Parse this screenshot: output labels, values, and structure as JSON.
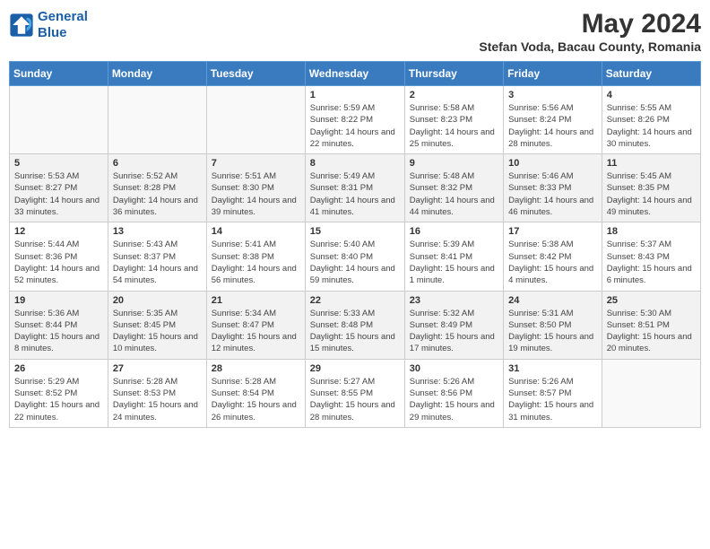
{
  "header": {
    "logo_line1": "General",
    "logo_line2": "Blue",
    "month_year": "May 2024",
    "location": "Stefan Voda, Bacau County, Romania"
  },
  "days_of_week": [
    "Sunday",
    "Monday",
    "Tuesday",
    "Wednesday",
    "Thursday",
    "Friday",
    "Saturday"
  ],
  "weeks": [
    [
      {
        "day": "",
        "info": ""
      },
      {
        "day": "",
        "info": ""
      },
      {
        "day": "",
        "info": ""
      },
      {
        "day": "1",
        "info": "Sunrise: 5:59 AM\nSunset: 8:22 PM\nDaylight: 14 hours and 22 minutes."
      },
      {
        "day": "2",
        "info": "Sunrise: 5:58 AM\nSunset: 8:23 PM\nDaylight: 14 hours and 25 minutes."
      },
      {
        "day": "3",
        "info": "Sunrise: 5:56 AM\nSunset: 8:24 PM\nDaylight: 14 hours and 28 minutes."
      },
      {
        "day": "4",
        "info": "Sunrise: 5:55 AM\nSunset: 8:26 PM\nDaylight: 14 hours and 30 minutes."
      }
    ],
    [
      {
        "day": "5",
        "info": "Sunrise: 5:53 AM\nSunset: 8:27 PM\nDaylight: 14 hours and 33 minutes."
      },
      {
        "day": "6",
        "info": "Sunrise: 5:52 AM\nSunset: 8:28 PM\nDaylight: 14 hours and 36 minutes."
      },
      {
        "day": "7",
        "info": "Sunrise: 5:51 AM\nSunset: 8:30 PM\nDaylight: 14 hours and 39 minutes."
      },
      {
        "day": "8",
        "info": "Sunrise: 5:49 AM\nSunset: 8:31 PM\nDaylight: 14 hours and 41 minutes."
      },
      {
        "day": "9",
        "info": "Sunrise: 5:48 AM\nSunset: 8:32 PM\nDaylight: 14 hours and 44 minutes."
      },
      {
        "day": "10",
        "info": "Sunrise: 5:46 AM\nSunset: 8:33 PM\nDaylight: 14 hours and 46 minutes."
      },
      {
        "day": "11",
        "info": "Sunrise: 5:45 AM\nSunset: 8:35 PM\nDaylight: 14 hours and 49 minutes."
      }
    ],
    [
      {
        "day": "12",
        "info": "Sunrise: 5:44 AM\nSunset: 8:36 PM\nDaylight: 14 hours and 52 minutes."
      },
      {
        "day": "13",
        "info": "Sunrise: 5:43 AM\nSunset: 8:37 PM\nDaylight: 14 hours and 54 minutes."
      },
      {
        "day": "14",
        "info": "Sunrise: 5:41 AM\nSunset: 8:38 PM\nDaylight: 14 hours and 56 minutes."
      },
      {
        "day": "15",
        "info": "Sunrise: 5:40 AM\nSunset: 8:40 PM\nDaylight: 14 hours and 59 minutes."
      },
      {
        "day": "16",
        "info": "Sunrise: 5:39 AM\nSunset: 8:41 PM\nDaylight: 15 hours and 1 minute."
      },
      {
        "day": "17",
        "info": "Sunrise: 5:38 AM\nSunset: 8:42 PM\nDaylight: 15 hours and 4 minutes."
      },
      {
        "day": "18",
        "info": "Sunrise: 5:37 AM\nSunset: 8:43 PM\nDaylight: 15 hours and 6 minutes."
      }
    ],
    [
      {
        "day": "19",
        "info": "Sunrise: 5:36 AM\nSunset: 8:44 PM\nDaylight: 15 hours and 8 minutes."
      },
      {
        "day": "20",
        "info": "Sunrise: 5:35 AM\nSunset: 8:45 PM\nDaylight: 15 hours and 10 minutes."
      },
      {
        "day": "21",
        "info": "Sunrise: 5:34 AM\nSunset: 8:47 PM\nDaylight: 15 hours and 12 minutes."
      },
      {
        "day": "22",
        "info": "Sunrise: 5:33 AM\nSunset: 8:48 PM\nDaylight: 15 hours and 15 minutes."
      },
      {
        "day": "23",
        "info": "Sunrise: 5:32 AM\nSunset: 8:49 PM\nDaylight: 15 hours and 17 minutes."
      },
      {
        "day": "24",
        "info": "Sunrise: 5:31 AM\nSunset: 8:50 PM\nDaylight: 15 hours and 19 minutes."
      },
      {
        "day": "25",
        "info": "Sunrise: 5:30 AM\nSunset: 8:51 PM\nDaylight: 15 hours and 20 minutes."
      }
    ],
    [
      {
        "day": "26",
        "info": "Sunrise: 5:29 AM\nSunset: 8:52 PM\nDaylight: 15 hours and 22 minutes."
      },
      {
        "day": "27",
        "info": "Sunrise: 5:28 AM\nSunset: 8:53 PM\nDaylight: 15 hours and 24 minutes."
      },
      {
        "day": "28",
        "info": "Sunrise: 5:28 AM\nSunset: 8:54 PM\nDaylight: 15 hours and 26 minutes."
      },
      {
        "day": "29",
        "info": "Sunrise: 5:27 AM\nSunset: 8:55 PM\nDaylight: 15 hours and 28 minutes."
      },
      {
        "day": "30",
        "info": "Sunrise: 5:26 AM\nSunset: 8:56 PM\nDaylight: 15 hours and 29 minutes."
      },
      {
        "day": "31",
        "info": "Sunrise: 5:26 AM\nSunset: 8:57 PM\nDaylight: 15 hours and 31 minutes."
      },
      {
        "day": "",
        "info": ""
      }
    ]
  ]
}
